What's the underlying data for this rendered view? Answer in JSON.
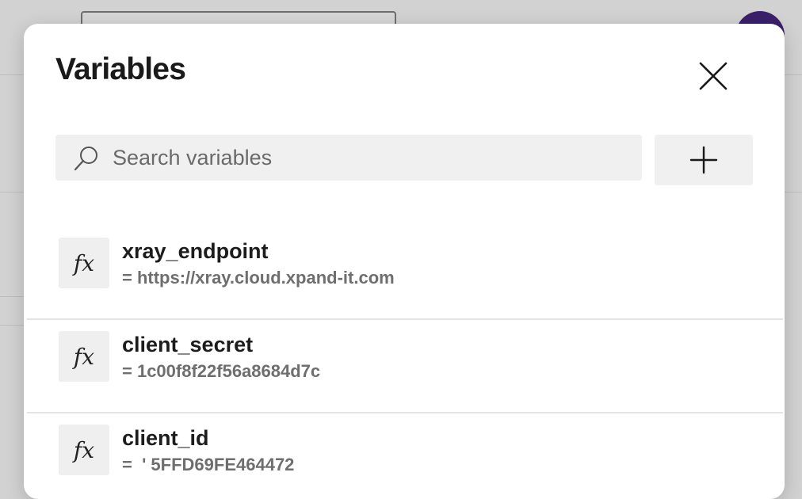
{
  "dialog": {
    "title": "Variables"
  },
  "search": {
    "placeholder": "Search variables",
    "value": ""
  },
  "variables": [
    {
      "name": "xray_endpoint",
      "value": "= https://xray.cloud.xpand-it.com",
      "icon_label": "fx"
    },
    {
      "name": "client_secret",
      "value": "= 1c00f8f22f56a8684d7c",
      "icon_label": "fx"
    },
    {
      "name": "client_id",
      "value": "=  ' 5FFD69FE464472",
      "icon_label": "fx"
    }
  ],
  "icons": {
    "close": "close-icon",
    "search": "search-icon",
    "add": "plus-icon",
    "variable": "fx-icon"
  },
  "colors": {
    "overlay": "#d2d2d2",
    "dialog_bg": "#ffffff",
    "field_bg": "#f0f0f0",
    "avatar": "#3b1f6b"
  }
}
